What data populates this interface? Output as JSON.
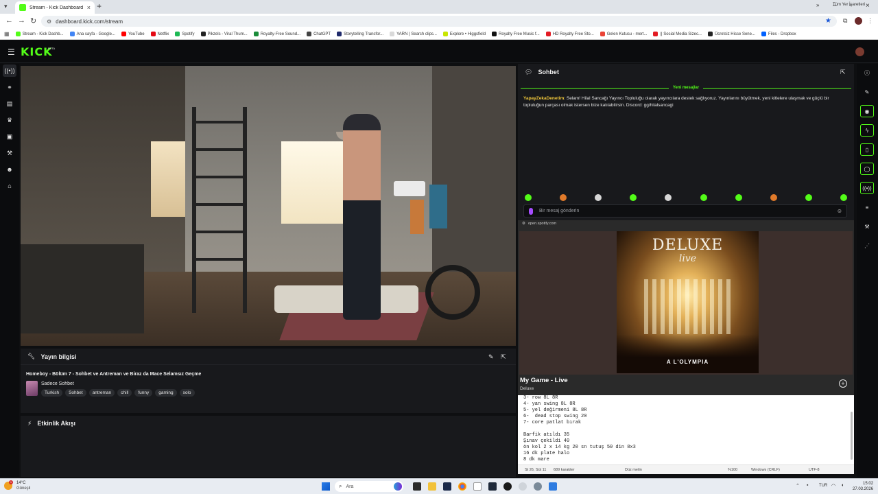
{
  "browser": {
    "tab_title": "Stream - Kick Dashboard",
    "url": "dashboard.kick.com/stream",
    "bookmarks": [
      {
        "label": "Stream - Kick Dashb...",
        "color": "#53fc18"
      },
      {
        "label": "Ana sayfa - Google...",
        "color": "#4285f4"
      },
      {
        "label": "YouTube",
        "color": "#ff0000"
      },
      {
        "label": "Netflix",
        "color": "#e50914"
      },
      {
        "label": "Spotify",
        "color": "#1db954"
      },
      {
        "label": "Pikzels - Viral Thum...",
        "color": "#222222"
      },
      {
        "label": "Royalty-Free Sound...",
        "color": "#1a8c3a"
      },
      {
        "label": "ChatGPT",
        "color": "#444444"
      },
      {
        "label": "Storytelling Transfor...",
        "color": "#1f2a6b"
      },
      {
        "label": "YARN | Search clips...",
        "color": "#d9d9d9"
      },
      {
        "label": "Explore • Higgsfield",
        "color": "#c8e600"
      },
      {
        "label": "Royalty Free Music f...",
        "color": "#111111"
      },
      {
        "label": "HD Royalty Free Sto...",
        "color": "#e31b23"
      },
      {
        "label": "Gelen Kutusu - mert...",
        "color": "#ea4335"
      },
      {
        "label": "|| Social Media Sizec...",
        "color": "#e31b23"
      },
      {
        "label": "Ücretsiz Hisse Sene...",
        "color": "#222222"
      },
      {
        "label": "Files - Dropbox",
        "color": "#0061ff"
      }
    ],
    "more_bookmarks": "»",
    "all_bookmarks": "Tüm Yer İşaretleri"
  },
  "kick": {
    "logo": "KICK",
    "logo_sup": "BETA",
    "leftnav_icons": [
      "broadcast-icon",
      "link-icon",
      "layout-icon",
      "trophy-icon",
      "video-icon",
      "wrench-icon",
      "users-icon",
      "bot-icon"
    ],
    "stream_info": {
      "header": "Yayın bilgisi",
      "title": "Homeboy - Bölüm 7 - Sohbet ve Antreman ve Biraz da Mace Selamsız Geçme",
      "category": "Sadece Sohbet",
      "tags": [
        "Turkish",
        "Sohbet",
        "antreman",
        "chill",
        "funny",
        "gaming",
        "solo"
      ]
    },
    "activity": {
      "header": "Etkinlik Akışı"
    },
    "chat": {
      "header": "Sohbet",
      "new_messages": "Yeni mesajlar",
      "message_user": "YapayZekaDenetim",
      "message_text": ": Selam! Hilal Sancağı Yayıncı Topluluğu olarak yayıncılara destek sağlıyoruz. Yayınlarını büyütmek, yeni kitlelere ulaşmak ve güçlü bir topluluğun parçası olmak istersen bize katılabilirsin. Discord: gg/hilalsancagi",
      "input_placeholder": "Bir mesaj gönderin"
    },
    "rightcol_icons": [
      "info-icon",
      "pencil-icon",
      "camera-icon",
      "bolt-icon",
      "clipboard-icon",
      "chat-bubble-icon",
      "broadcast-icon",
      "stack-icon",
      "wrench-icon",
      "share-icon"
    ]
  },
  "spotify": {
    "origin": "open.spotify.com",
    "cover_title": "DELUXE",
    "cover_subtitle": "live",
    "cover_venue": "A L'OLYMPIA",
    "track_title": "My Game - Live",
    "artist": "Deluxe"
  },
  "notepad": {
    "lines": [
      "3- row 8L 8R",
      "4- yan swing 8L 8R",
      "5- yel değirmeni 8L 8R",
      "6-  dead stop swing 20",
      "7- core patlat bırak",
      "",
      "Barfik atıldı 35",
      "Şınav çekildi 40",
      "ön kol 2 x 14 kg 20 sn tutuş 50 din 8x3",
      "16 dk plate halo",
      "8 dk mare"
    ],
    "status_position": "St 26, Süt 11",
    "status_chars": "689 karakter",
    "status_mode": "Düz metin",
    "status_zoom": "%100",
    "status_eol": "Windows (CRLF)",
    "status_enc": "UTF-8"
  },
  "taskbar": {
    "temp": "14°C",
    "weather": "Güneşli",
    "badge": "1",
    "search_placeholder": "Ara",
    "lang": "TUR",
    "time": "15:02",
    "date": "27.03.2026"
  }
}
